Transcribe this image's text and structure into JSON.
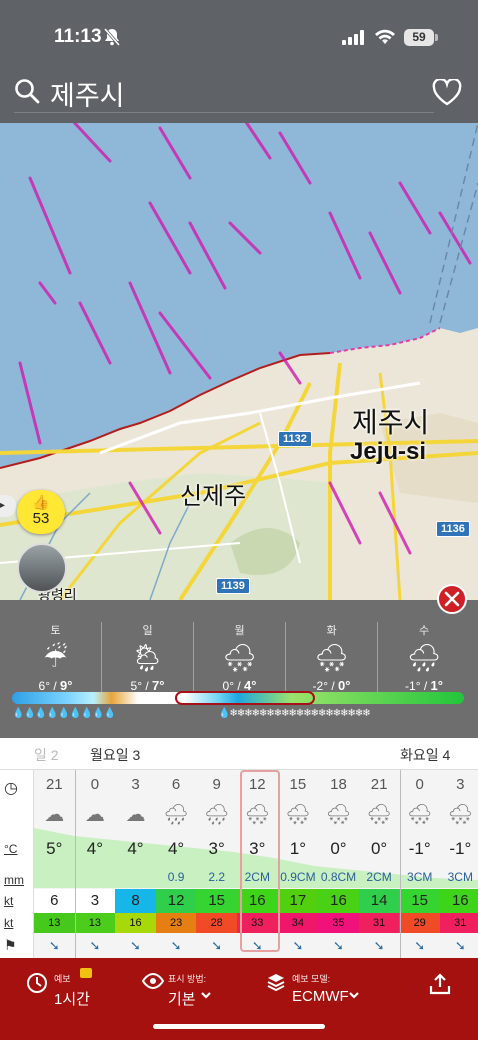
{
  "status": {
    "time": "11:13",
    "battery": "59"
  },
  "search": {
    "query": "제주시"
  },
  "map": {
    "labels": {
      "jeju_kr": "제주시",
      "jeju_en": "Jeju-si",
      "sinjeju": "신제주",
      "gwang": "광령리"
    },
    "roads": [
      "1132",
      "1136",
      "1139"
    ],
    "likes": "53"
  },
  "overlay": {
    "days": [
      {
        "name": "토",
        "icon": "☔",
        "low": "6°",
        "high": "9°"
      },
      {
        "name": "일",
        "icon": "🌦",
        "low": "5°",
        "high": "7°"
      },
      {
        "name": "월",
        "icon": "🌨",
        "low": "0°",
        "high": "4°"
      },
      {
        "name": "화",
        "icon": "🌨",
        "low": "-2°",
        "high": "0°"
      },
      {
        "name": "수",
        "icon": "🌧",
        "low": "-1°",
        "high": "1°"
      }
    ]
  },
  "table": {
    "day_labels": {
      "prev": "일 2",
      "monday": "월요일 3",
      "tuesday": "화요일 4"
    },
    "row_labels": {
      "hour": "◷",
      "temp": "°C",
      "mm": "mm",
      "wind": "kt",
      "gust": "kt",
      "dir": "⚑"
    },
    "hours": [
      "21",
      "0",
      "3",
      "6",
      "9",
      "12",
      "15",
      "18",
      "21",
      "0",
      "3"
    ],
    "temps": [
      "5°",
      "4°",
      "4°",
      "4°",
      "3°",
      "3°",
      "1°",
      "0°",
      "0°",
      "-1°",
      "-1°"
    ],
    "precip": [
      "",
      "",
      "",
      "0.9",
      "2.2",
      "2CM",
      "0.9CM",
      "0.8CM",
      "2CM",
      "3CM",
      "3CM"
    ],
    "wind": [
      "6",
      "3",
      "8",
      "12",
      "15",
      "16",
      "17",
      "16",
      "14",
      "15",
      "16"
    ],
    "gust": [
      "13",
      "13",
      "16",
      "23",
      "28",
      "33",
      "34",
      "35",
      "31",
      "29",
      "31"
    ],
    "wind_colors": [
      "#ffffff",
      "#ffffff",
      "#17b6e8",
      "#2fcf4b",
      "#36d430",
      "#3ed41a",
      "#52d00f",
      "#49d115",
      "#2fcf4b",
      "#36d430",
      "#3ed41a"
    ],
    "gust_colors": [
      "#46c81d",
      "#4ccc1b",
      "#a6d80a",
      "#e67f12",
      "#f04a26",
      "#f0205e",
      "#f0166a",
      "#f0127a",
      "#f0205e",
      "#f04a26",
      "#f0205e"
    ],
    "selected_hour": "12"
  },
  "bottom": {
    "forecast_small": "예보",
    "forecast_value": "1시간",
    "display_small": "표시 방법:",
    "display_value": "기본",
    "model_small": "예보 모델:",
    "model_value": "ECMWF"
  },
  "colors": {
    "header": "#5f6266",
    "bottom": "#a4110f",
    "sea": "#8fb8d8",
    "accent_red": "#cf2027"
  }
}
